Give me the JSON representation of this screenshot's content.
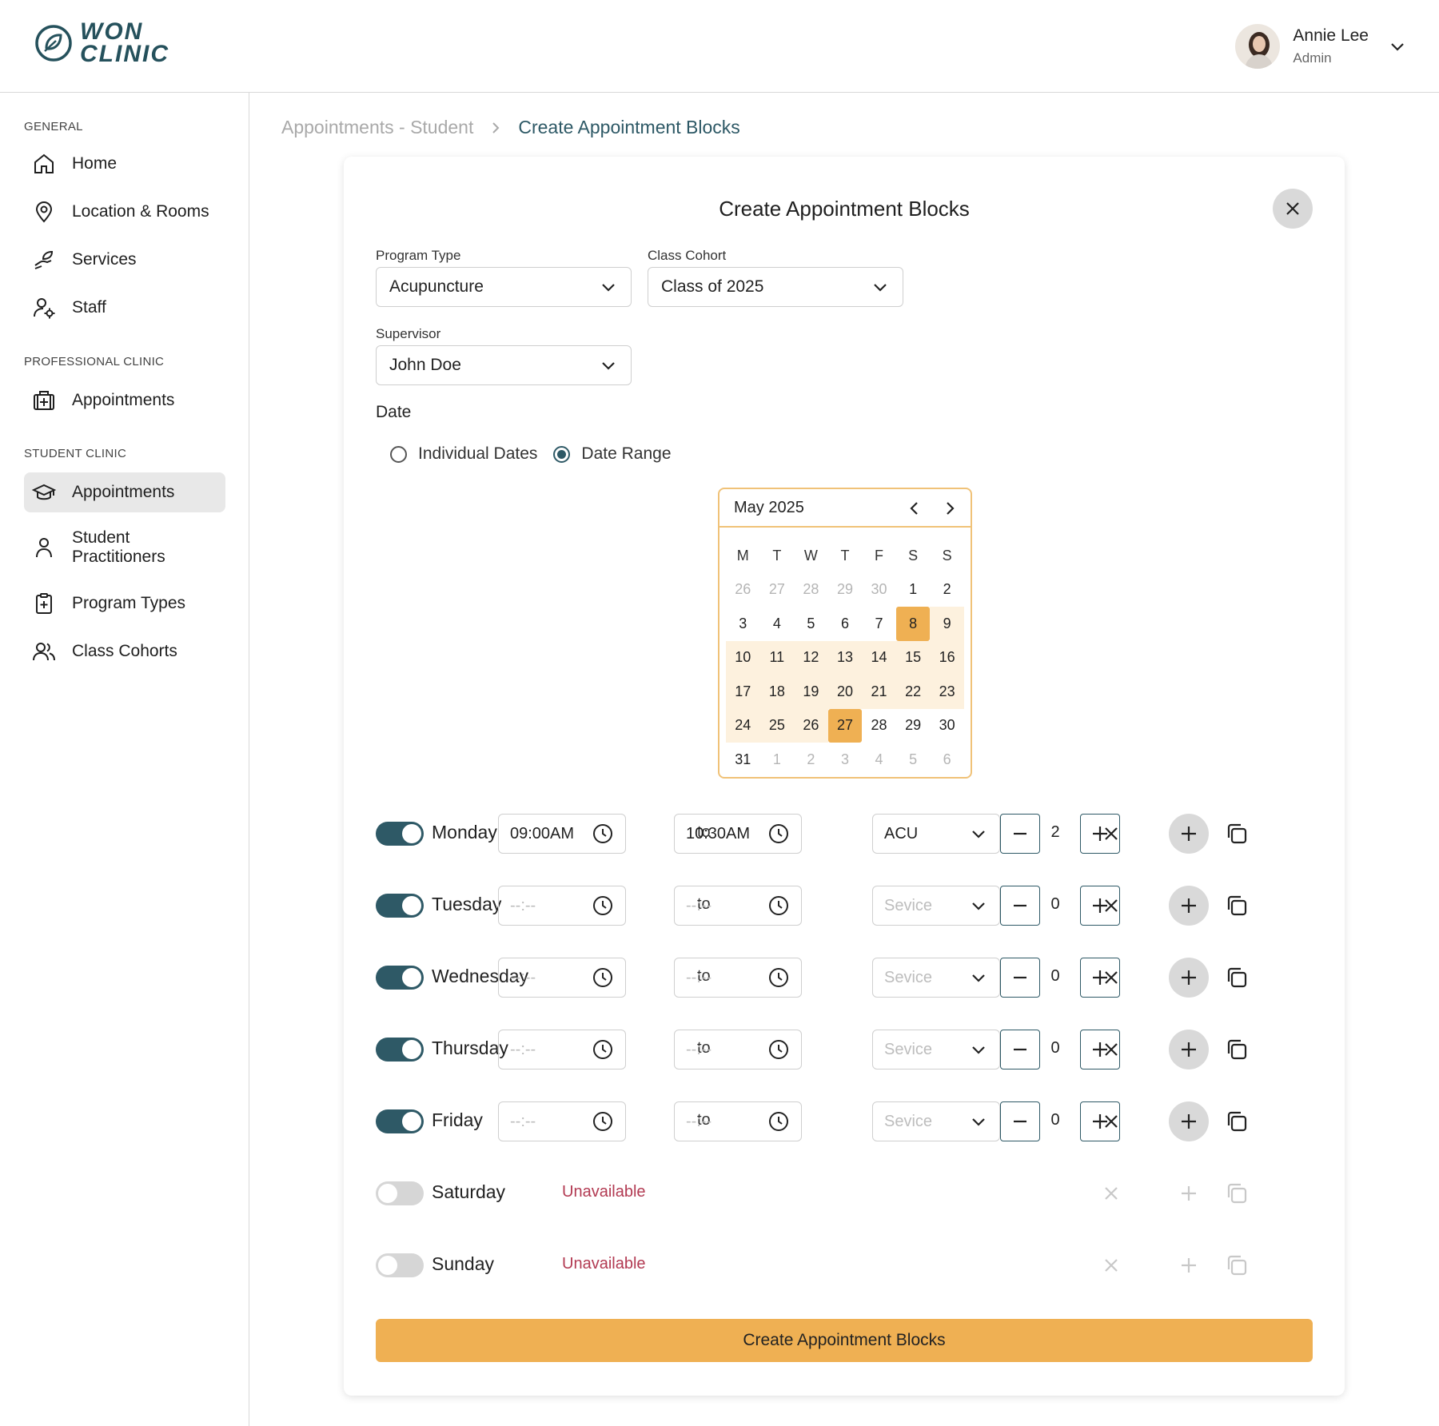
{
  "brand": {
    "line1": "WON",
    "line2": "CLINIC",
    "color": "#25515c"
  },
  "user": {
    "name": "Annie Lee",
    "role": "Admin"
  },
  "sidebar": {
    "sections": [
      {
        "title": "GENERAL"
      },
      {
        "title": "PROFESSIONAL CLINIC"
      },
      {
        "title": "STUDENT CLINIC"
      }
    ],
    "items": [
      {
        "label": "Home",
        "icon": "home-icon"
      },
      {
        "label": "Location & Rooms",
        "icon": "location-pin-icon"
      },
      {
        "label": "Services",
        "icon": "hand-leaf-icon"
      },
      {
        "label": "Staff",
        "icon": "user-gear-icon"
      },
      {
        "label": "Appointments",
        "icon": "medical-bag-icon"
      },
      {
        "label": "Appointments",
        "icon": "graduation-cap-icon",
        "active": true
      },
      {
        "label": "Student Practitioners",
        "icon": "user-icon"
      },
      {
        "label": "Program Types",
        "icon": "clipboard-plus-icon"
      },
      {
        "label": "Class Cohorts",
        "icon": "users-icon"
      }
    ]
  },
  "breadcrumb": {
    "prev": "Appointments - Student",
    "current": "Create Appointment Blocks"
  },
  "modal": {
    "title": "Create Appointment Blocks",
    "program_type": {
      "label": "Program Type",
      "value": "Acupuncture"
    },
    "class_cohort": {
      "label": "Class Cohort",
      "value": "Class of 2025"
    },
    "supervisor": {
      "label": "Supervisor",
      "value": "John Doe"
    },
    "date_label": "Date",
    "date_mode": {
      "individual": "Individual Dates",
      "range": "Date Range",
      "selected": "range"
    },
    "submit_label": "Create Appointment Blocks"
  },
  "calendar": {
    "month_label": "May 2025",
    "weekdays": [
      "M",
      "T",
      "W",
      "T",
      "F",
      "S",
      "S"
    ],
    "weeks": [
      [
        "26",
        "27",
        "28",
        "29",
        "30",
        "1",
        "2"
      ],
      [
        "3",
        "4",
        "5",
        "6",
        "7",
        "8",
        "9"
      ],
      [
        "10",
        "11",
        "12",
        "13",
        "14",
        "15",
        "16"
      ],
      [
        "17",
        "18",
        "19",
        "20",
        "21",
        "22",
        "23"
      ],
      [
        "24",
        "25",
        "26",
        "27",
        "28",
        "29",
        "30"
      ],
      [
        "31",
        "1",
        "2",
        "3",
        "4",
        "5",
        "6"
      ]
    ],
    "range_start": "8",
    "range_end": "27",
    "accent": "#efb053",
    "range_bg": "#fdf1de"
  },
  "schedule": {
    "to_label": "to",
    "unavailable_label": "Unavailable",
    "days": [
      {
        "name": "Monday",
        "enabled": true,
        "start": "09:00AM",
        "end": "10:30AM",
        "service": "ACU",
        "count": "2"
      },
      {
        "name": "Tuesday",
        "enabled": true,
        "start": "--:--",
        "end": "--:--",
        "service": "Sevice",
        "count": "0"
      },
      {
        "name": "Wednesday",
        "enabled": true,
        "start": "--:--",
        "end": "--:--",
        "service": "Sevice",
        "count": "0"
      },
      {
        "name": "Thursday",
        "enabled": true,
        "start": "--:--",
        "end": "--:--",
        "service": "Sevice",
        "count": "0"
      },
      {
        "name": "Friday",
        "enabled": true,
        "start": "--:--",
        "end": "--:--",
        "service": "Sevice",
        "count": "0"
      },
      {
        "name": "Saturday",
        "enabled": false
      },
      {
        "name": "Sunday",
        "enabled": false
      }
    ]
  },
  "colors": {
    "primary": "#2e5966",
    "accent": "#efb053",
    "danger": "#b23a52"
  }
}
